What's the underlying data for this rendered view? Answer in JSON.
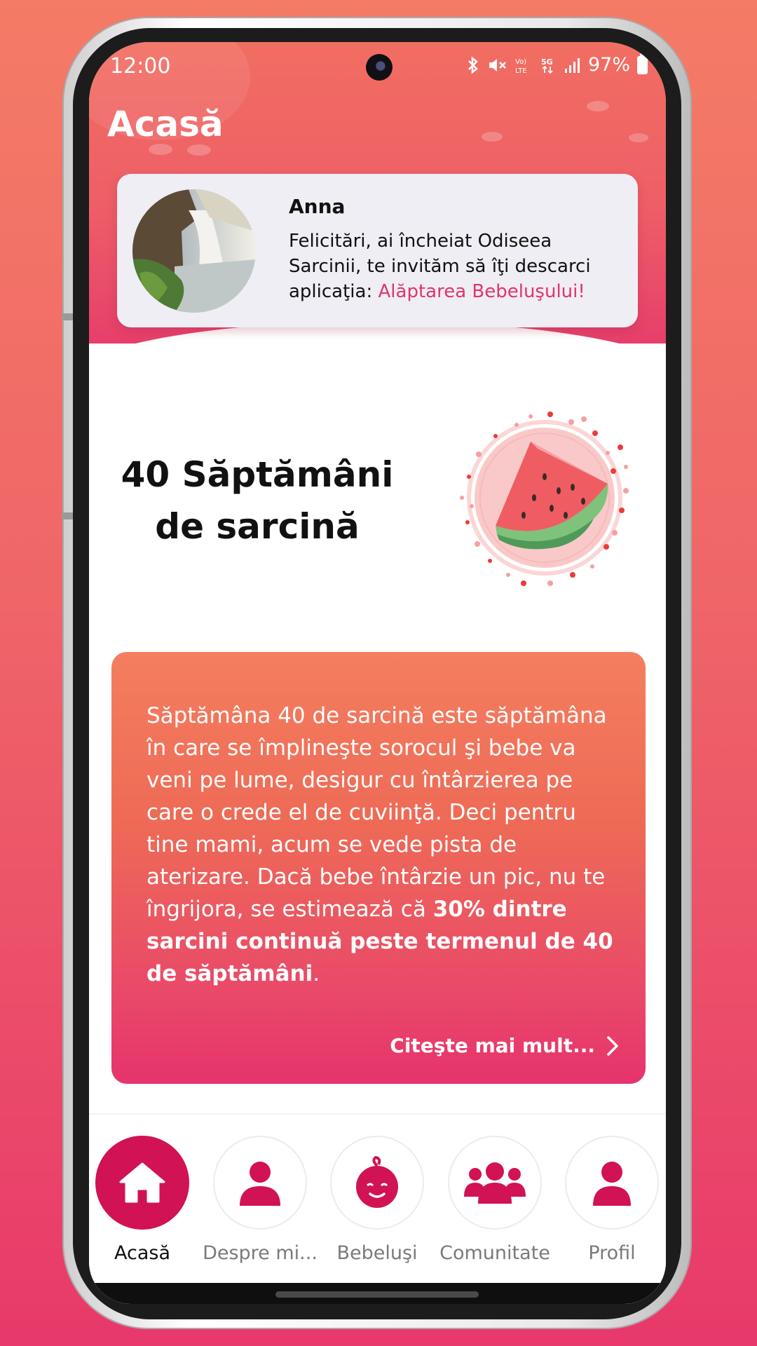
{
  "status_bar": {
    "time": "12:00",
    "battery": "97%",
    "icons": [
      "bluetooth-icon",
      "mute-icon",
      "volte-icon",
      "5g-icon",
      "signal-icon",
      "battery-icon"
    ]
  },
  "header": {
    "title": "Acasă"
  },
  "profile": {
    "name": "Anna",
    "message": "Felicitări, ai încheiat Odiseea Sarcinii, te invităm să îţi descarci aplicaţia: ",
    "link": "Alăptarea Bebeluşului!"
  },
  "week": {
    "title": "40 Săptămâni de sarcină",
    "fruit_icon": "watermelon-icon"
  },
  "info": {
    "text_plain": "Săptămâna 40 de sarcină este săptămâna în care se împlineşte sorocul şi bebe va veni pe lume, desigur cu întârzierea pe care o crede el de cuviinţă. Deci pentru tine mami, acum se vede pista de aterizare. Dacă bebe întârzie un pic, nu te îngrijora, se estimează că ",
    "text_bold": "30% dintre sarcini continuă peste termenul de 40 de săptămâni",
    "text_end": ".",
    "read_more": "Citeşte mai mult..."
  },
  "nav": {
    "items": [
      {
        "label": "Acasă",
        "icon": "home-icon",
        "active": true
      },
      {
        "label": "Despre mi...",
        "icon": "person-icon",
        "active": false
      },
      {
        "label": "Bebeluşi",
        "icon": "baby-face-icon",
        "active": false
      },
      {
        "label": "Comunitate",
        "icon": "group-icon",
        "active": false
      },
      {
        "label": "Profil",
        "icon": "profile-icon",
        "active": false
      }
    ]
  },
  "colors": {
    "accent": "#d11255",
    "link": "#e0356b",
    "header_top": "#f16e62",
    "card_top": "#f47e5f",
    "card_bottom": "#e6336c"
  }
}
